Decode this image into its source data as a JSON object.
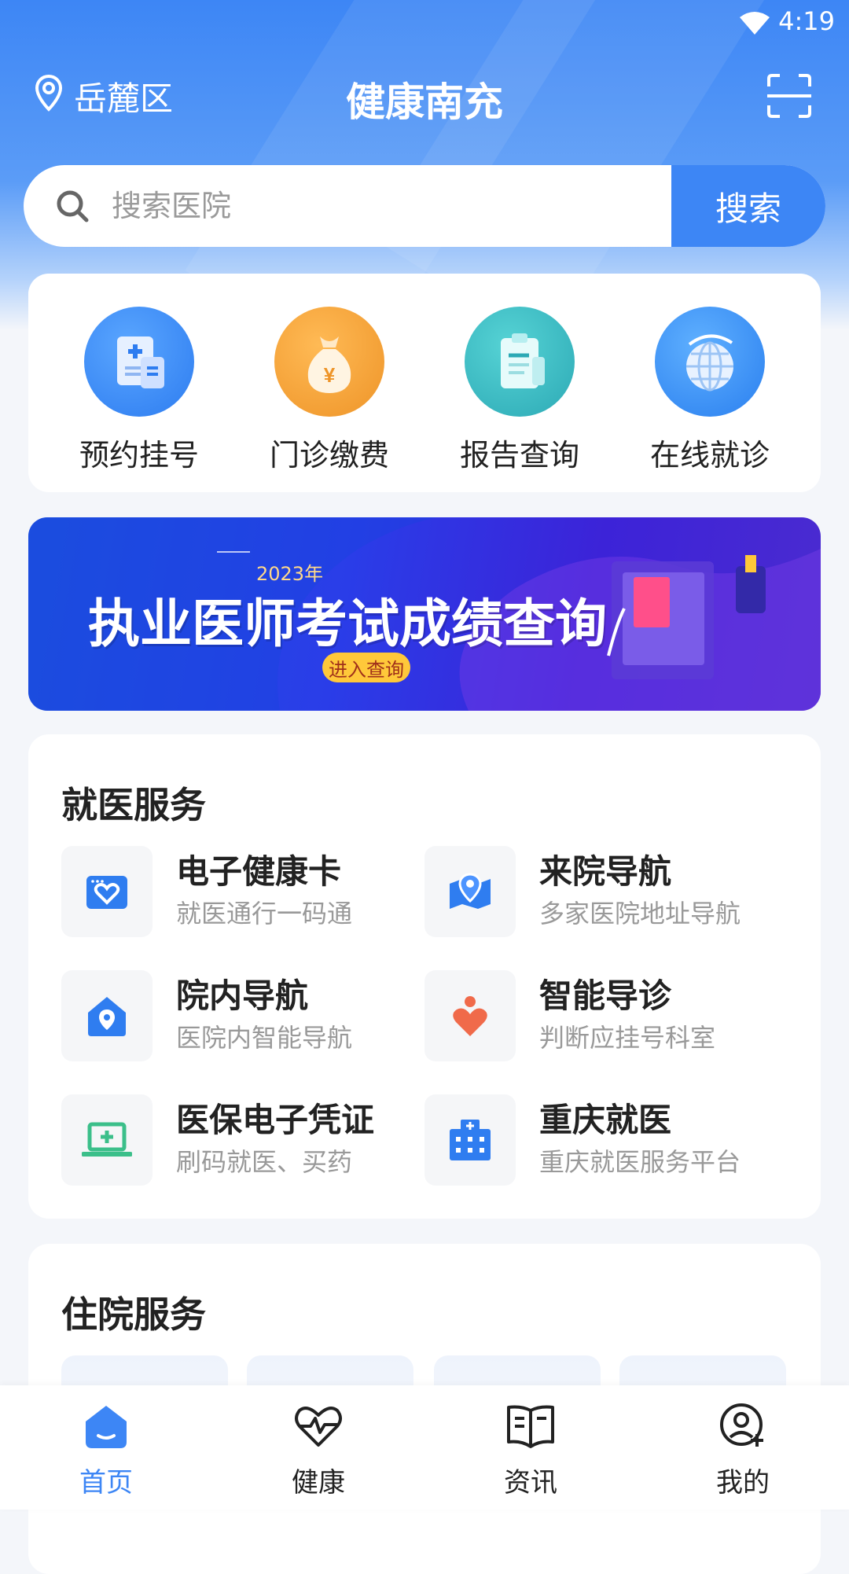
{
  "status_bar": {
    "time": "4:19"
  },
  "header": {
    "location": "岳麓区",
    "title": "健康南充"
  },
  "search": {
    "placeholder": "搜索医院",
    "button_label": "搜索"
  },
  "quick_actions": [
    {
      "label": "预约挂号",
      "icon": "appointment-icon"
    },
    {
      "label": "门诊缴费",
      "icon": "payment-bag-icon"
    },
    {
      "label": "报告查询",
      "icon": "report-clipboard-icon"
    },
    {
      "label": "在线就诊",
      "icon": "online-globe-icon"
    }
  ],
  "banner": {
    "year": "2023年",
    "title": "执业医师考试成绩查询",
    "cta": "进入查询"
  },
  "medical_services": {
    "title": "就医服务",
    "items": [
      {
        "name": "电子健康卡",
        "desc": "就医通行一码通",
        "icon": "health-card-icon"
      },
      {
        "name": "来院导航",
        "desc": "多家医院地址导航",
        "icon": "map-pin-icon"
      },
      {
        "name": "院内导航",
        "desc": "医院内智能导航",
        "icon": "house-pin-icon"
      },
      {
        "name": "智能导诊",
        "desc": "判断应挂号科室",
        "icon": "person-heart-icon"
      },
      {
        "name": "医保电子凭证",
        "desc": "刷码就医、买药",
        "icon": "laptop-plus-icon"
      },
      {
        "name": "重庆就医",
        "desc": "重庆就医服务平台",
        "icon": "hospital-building-icon"
      }
    ]
  },
  "inpatient_services": {
    "title": "住院服务"
  },
  "bottom_nav": [
    {
      "label": "首页",
      "icon": "home-icon",
      "active": true
    },
    {
      "label": "健康",
      "icon": "heart-pulse-icon",
      "active": false
    },
    {
      "label": "资讯",
      "icon": "book-icon",
      "active": false
    },
    {
      "label": "我的",
      "icon": "user-add-icon",
      "active": false
    }
  ],
  "colors": {
    "primary": "#3d86f5",
    "orange": "#f0a136",
    "teal": "#3cbcc4",
    "green": "#3bbf8a",
    "coral": "#f06a4a"
  }
}
